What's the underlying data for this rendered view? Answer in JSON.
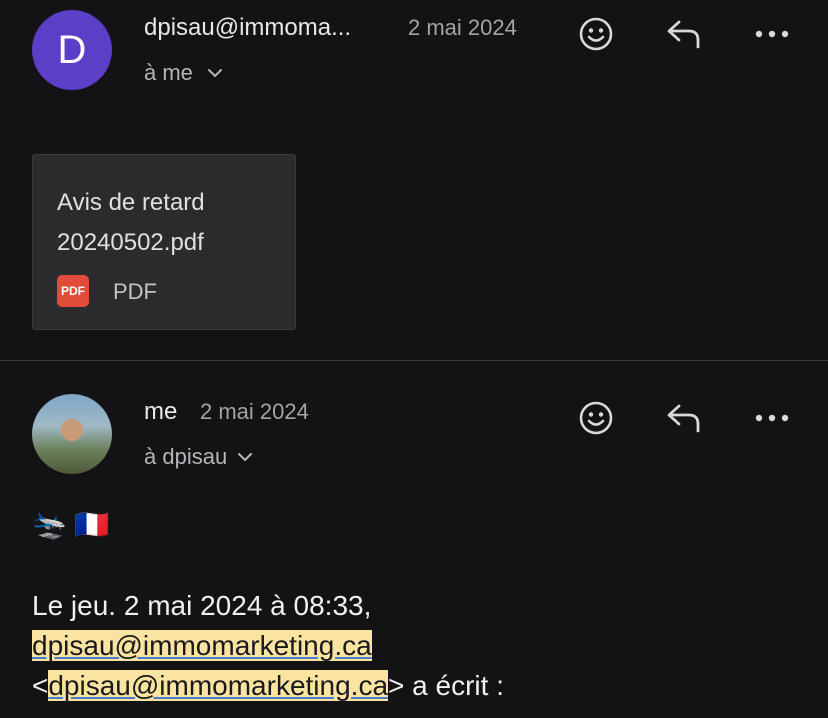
{
  "message1": {
    "avatar_letter": "D",
    "sender": "dpisau@immoma...",
    "date": "2 mai 2024",
    "recipient": "à me",
    "attachment": {
      "name_line1": "Avis de retard",
      "name_line2": "20240502.pdf",
      "badge": "PDF",
      "type_label": "PDF"
    }
  },
  "message2": {
    "sender": "me",
    "date": "2 mai 2024",
    "recipient": "à dpisau",
    "emoji_line": "🛬 🇫🇷",
    "quote_intro": "Le jeu. 2 mai 2024 à 08:33,",
    "quote_email": "dpisau@immomarketing.ca",
    "quote_open": "<",
    "quote_email2": "dpisau@immomarketing.ca",
    "quote_close": "> a écrit :"
  },
  "icons": {
    "emoji": "smiley-icon",
    "reply": "reply-icon",
    "more": "more-icon",
    "chevron": "chevron-down-icon"
  },
  "colors": {
    "background": "#131214",
    "avatar": "#5b3fc7",
    "highlight": "#fbe3a1",
    "pdf": "#e04b3a"
  }
}
